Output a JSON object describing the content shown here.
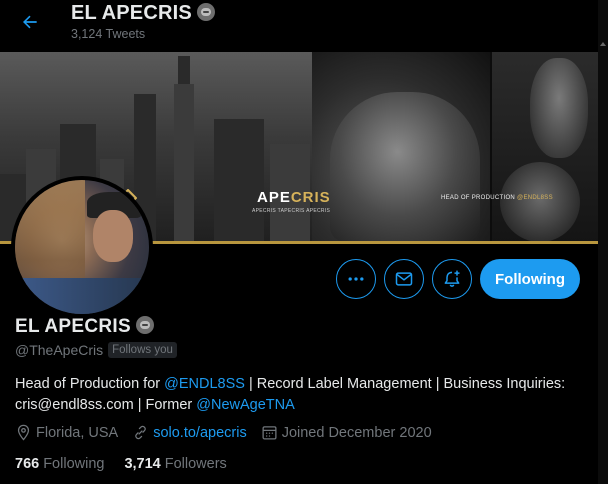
{
  "header": {
    "title": "EL APECRIS",
    "tweet_count": "3,124 Tweets"
  },
  "banner": {
    "logo_main": "APE",
    "logo_accent": "CRIS",
    "socials": "APECRIS   TAPECRIS   APECRIS",
    "head_text": "HEAD OF PRODUCTION ",
    "head_link": "@ENDL8SS"
  },
  "profile": {
    "name": "EL APECRIS",
    "handle": "@TheApeCris",
    "follows_you": "Follows you",
    "bio": {
      "part1": "Head of Production for ",
      "link1": "@ENDL8SS",
      "part2": " | Record Label Management | Business Inquiries: cris@endl8ss.com | Former ",
      "link2": "@NewAgeTNA"
    },
    "location": "Florida, USA",
    "website": "solo.to/apecris",
    "joined": "Joined December 2020",
    "following_count": "766",
    "following_label": "Following",
    "followers_count": "3,714",
    "followers_label": "Followers"
  },
  "actions": {
    "more_icon": "more-icon",
    "message_icon": "mail-icon",
    "notify_icon": "bell-plus-icon",
    "follow_button": "Following"
  },
  "colors": {
    "accent": "#1d9bf0",
    "background": "#000000",
    "text_primary": "#e7e9ea",
    "text_secondary": "#71767b"
  }
}
